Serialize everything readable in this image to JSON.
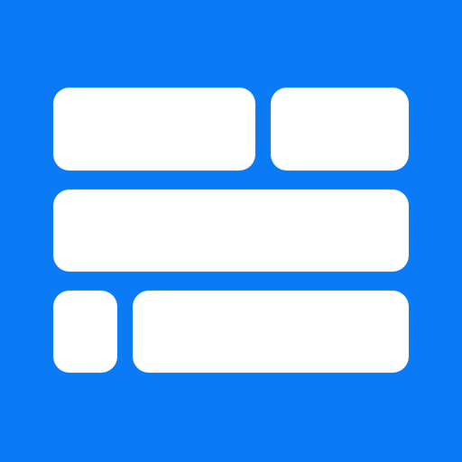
{
  "app_icon": {
    "icon": "tile-layout-icon",
    "colors": {
      "background": "#0A7BF5",
      "tile": "#FFFFFF"
    },
    "tiles": [
      "top-left",
      "top-right",
      "middle",
      "bottom-left",
      "bottom-right"
    ]
  }
}
